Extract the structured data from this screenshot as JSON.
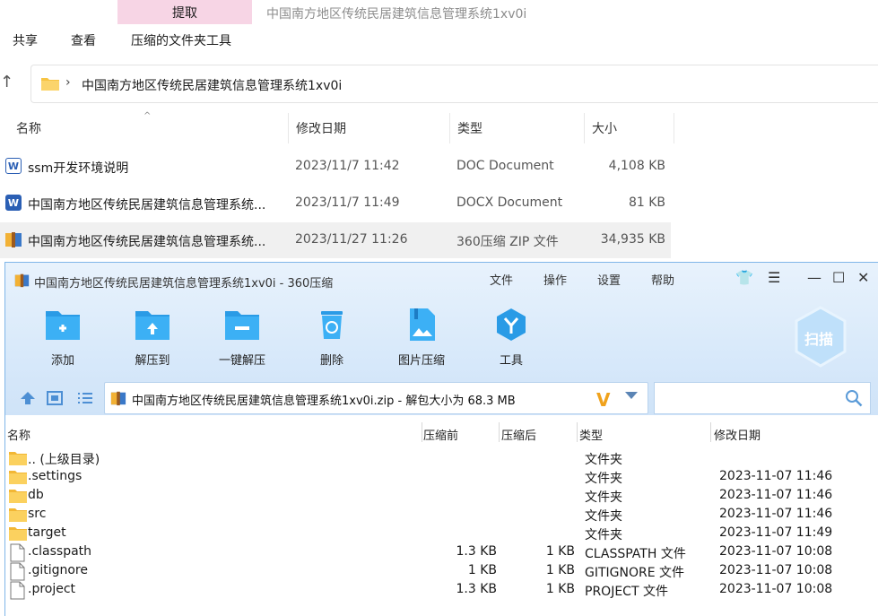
{
  "explorer": {
    "ribbon_tab": "提取",
    "window_title": "中国南方地区传统民居建筑信息管理系统1xv0i",
    "menus": [
      "共享",
      "查看",
      "压缩的文件夹工具"
    ],
    "address_path": "中国南方地区传统民居建筑信息管理系统1xv0i",
    "columns": [
      "名称",
      "修改日期",
      "类型",
      "大小"
    ],
    "files": [
      {
        "name": "ssm开发环境说明",
        "date": "2023/11/7 11:42",
        "type": "DOC Document",
        "size": "4,108 KB",
        "icon": "word-doc-icon"
      },
      {
        "name": "中国南方地区传统民居建筑信息管理系统...",
        "date": "2023/11/7 11:49",
        "type": "DOCX Document",
        "size": "81 KB",
        "icon": "word-docx-icon"
      },
      {
        "name": "中国南方地区传统民居建筑信息管理系统...",
        "date": "2023/11/27 11:26",
        "type": "360压缩 ZIP 文件",
        "size": "34,935 KB",
        "icon": "zip-archive-icon"
      }
    ]
  },
  "zipwin": {
    "title": "中国南方地区传统民居建筑信息管理系统1xv0i - 360压缩",
    "menus": [
      "文件",
      "操作",
      "设置",
      "帮助"
    ],
    "tools": [
      "添加",
      "解压到",
      "一键解压",
      "删除",
      "图片压缩",
      "工具"
    ],
    "scan_label": "扫描",
    "path_text": "中国南方地区传统民居建筑信息管理系统1xv0i.zip - 解包大小为 68.3 MB",
    "columns": [
      "名称",
      "压缩前",
      "压缩后",
      "类型",
      "修改日期"
    ],
    "rows": [
      {
        "name": ".. (上级目录)",
        "before": "",
        "after": "",
        "type": "文件夹",
        "date": "",
        "kind": "folder"
      },
      {
        "name": ".settings",
        "before": "",
        "after": "",
        "type": "文件夹",
        "date": "2023-11-07 11:46",
        "kind": "folder"
      },
      {
        "name": "db",
        "before": "",
        "after": "",
        "type": "文件夹",
        "date": "2023-11-07 11:46",
        "kind": "folder"
      },
      {
        "name": "src",
        "before": "",
        "after": "",
        "type": "文件夹",
        "date": "2023-11-07 11:46",
        "kind": "folder"
      },
      {
        "name": "target",
        "before": "",
        "after": "",
        "type": "文件夹",
        "date": "2023-11-07 11:49",
        "kind": "folder"
      },
      {
        "name": ".classpath",
        "before": "1.3 KB",
        "after": "1 KB",
        "type": "CLASSPATH 文件",
        "date": "2023-11-07 10:08",
        "kind": "file"
      },
      {
        "name": ".gitignore",
        "before": "1 KB",
        "after": "1 KB",
        "type": "GITIGNORE 文件",
        "date": "2023-11-07 10:08",
        "kind": "file"
      },
      {
        "name": ".project",
        "before": "1.3 KB",
        "after": "1 KB",
        "type": "PROJECT 文件",
        "date": "2023-11-07 10:08",
        "kind": "file"
      }
    ]
  }
}
